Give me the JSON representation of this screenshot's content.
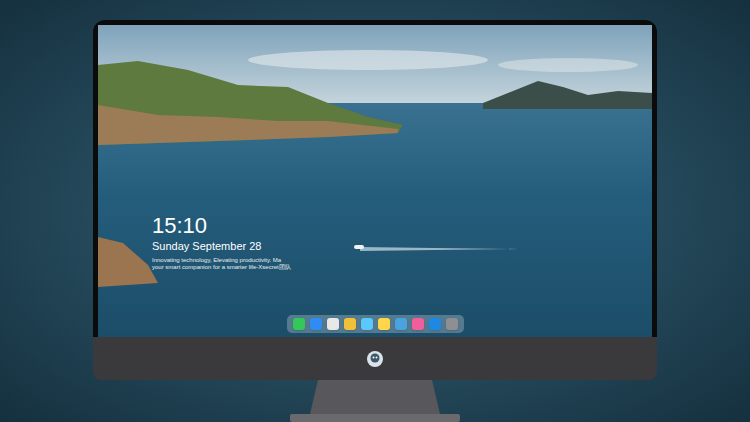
{
  "lock_screen": {
    "time": "15:10",
    "date": "Sunday September 28",
    "tagline": [
      "Innovating technology, Elevating productivity. Ma",
      "your smart companion for a smarter life-Xsecret团队"
    ]
  },
  "dock": {
    "apps": [
      {
        "color": "#34c759"
      },
      {
        "color": "#2f8cf5"
      },
      {
        "color": "#e8e8e8"
      },
      {
        "color": "#f0c23a"
      },
      {
        "color": "#5ac8fa"
      },
      {
        "color": "#ffd54a"
      },
      {
        "color": "#4aa3df"
      },
      {
        "color": "#f25d9c"
      },
      {
        "color": "#1e88e5"
      },
      {
        "color": "#8e8e93"
      }
    ]
  }
}
